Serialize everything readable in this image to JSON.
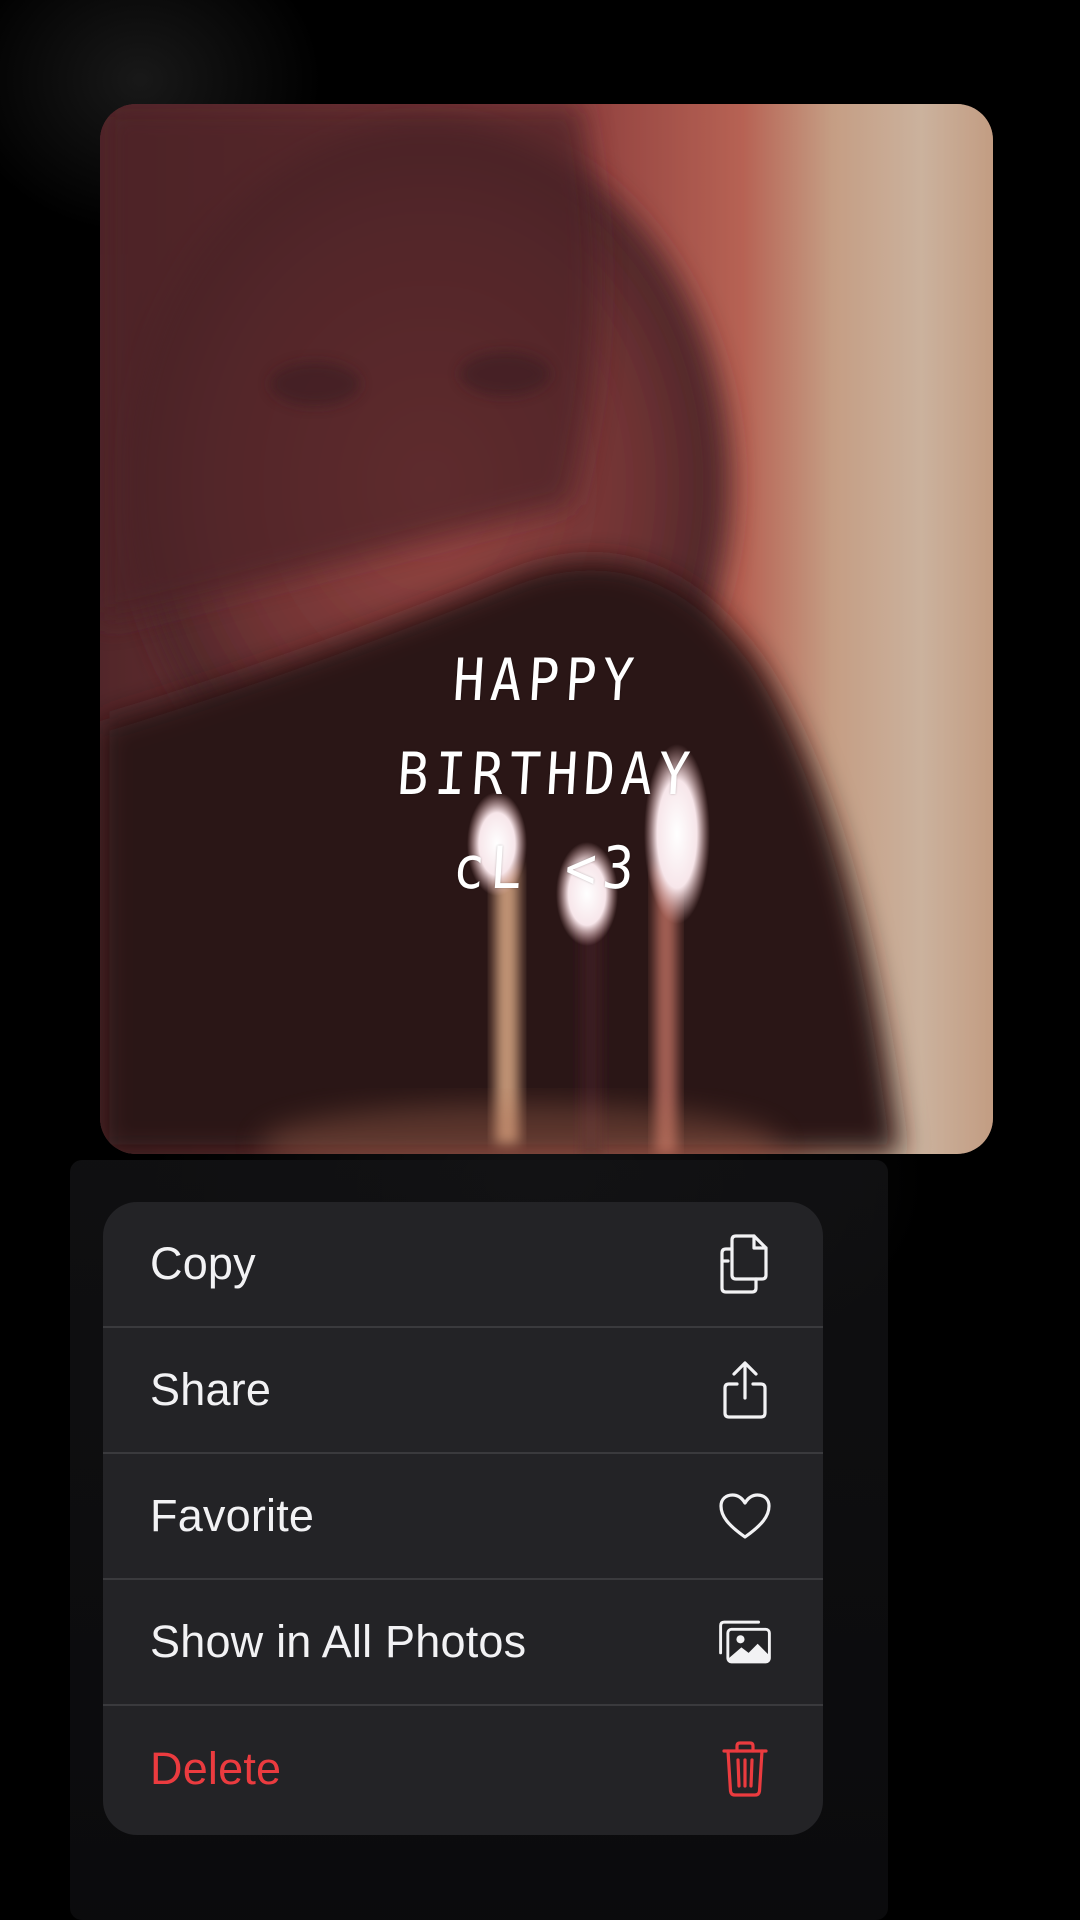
{
  "photo": {
    "overlay_lines": [
      "HAPPY",
      "BIRTHDAY",
      "cL <3"
    ]
  },
  "context_menu": {
    "items": [
      {
        "label": "Copy",
        "icon": "copy-icon",
        "destructive": false
      },
      {
        "label": "Share",
        "icon": "share-icon",
        "destructive": false
      },
      {
        "label": "Favorite",
        "icon": "heart-icon",
        "destructive": false
      },
      {
        "label": "Show in All Photos",
        "icon": "photos-icon",
        "destructive": false
      },
      {
        "label": "Delete",
        "icon": "trash-icon",
        "destructive": true
      }
    ]
  },
  "colors": {
    "background": "#000000",
    "menu_background": "#232326",
    "menu_text": "#f2f2f4",
    "destructive": "#eb3b3f",
    "separator": "#3a3a3d"
  }
}
